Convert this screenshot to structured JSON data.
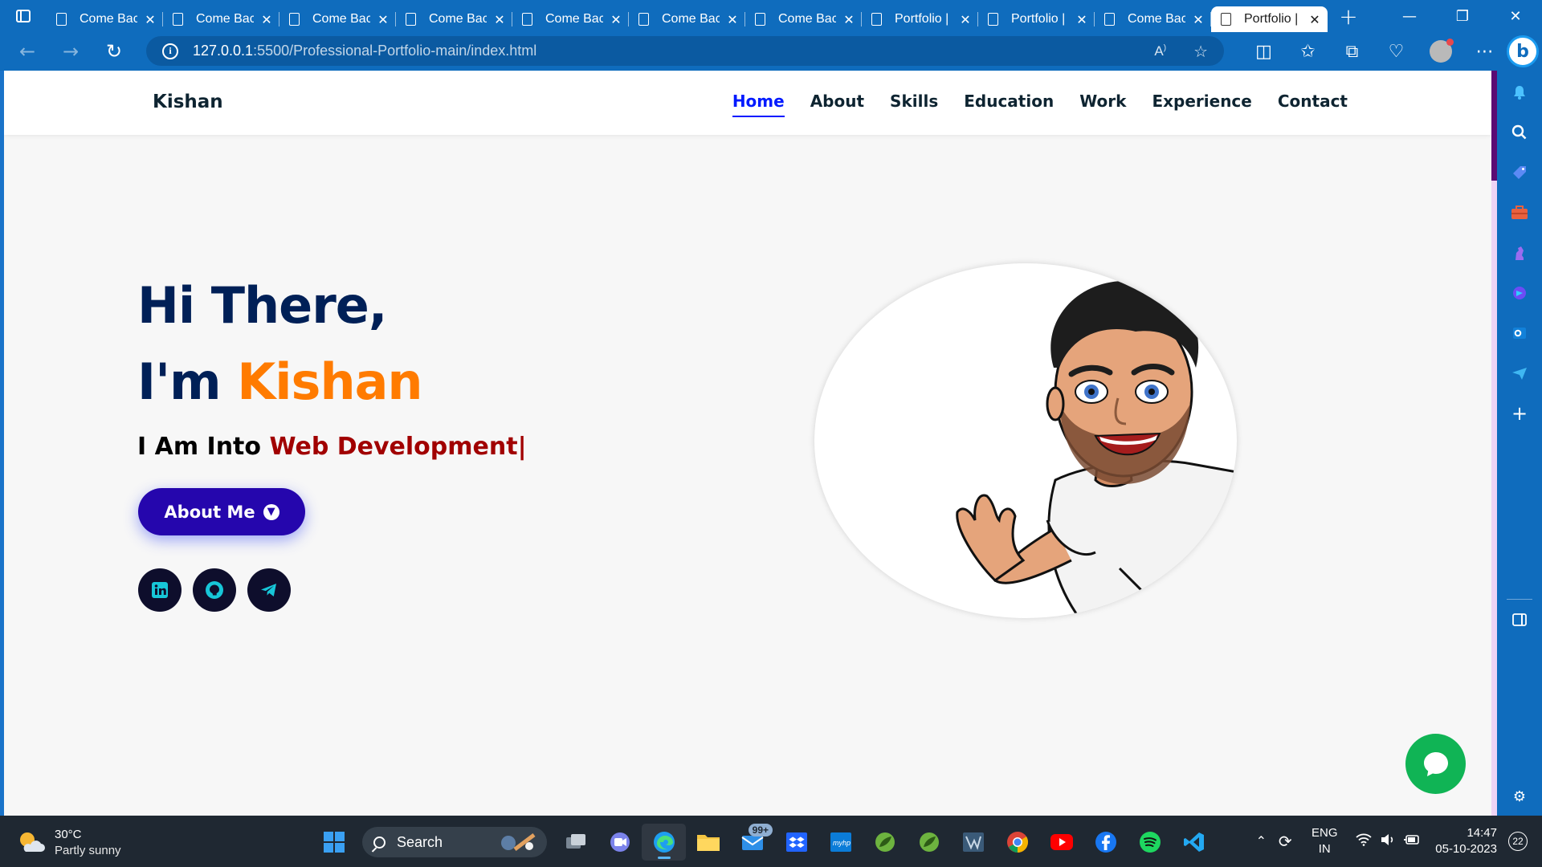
{
  "browser": {
    "tabs": [
      {
        "label": "Come Back"
      },
      {
        "label": "Come Back"
      },
      {
        "label": "Come Back"
      },
      {
        "label": "Come Back"
      },
      {
        "label": "Come Back"
      },
      {
        "label": "Come Back"
      },
      {
        "label": "Come Back"
      },
      {
        "label": "Portfolio |"
      },
      {
        "label": "Portfolio |"
      },
      {
        "label": "Come Back"
      },
      {
        "label": "Portfolio |"
      }
    ],
    "active_tab_index": 10,
    "new_tab_label": "+",
    "address": {
      "host": "127.0.0.1",
      "path": ":5500/Professional-Portfolio-main/index.html"
    }
  },
  "site": {
    "logo": "Kishan",
    "nav": [
      {
        "label": "Home",
        "active": true
      },
      {
        "label": "About"
      },
      {
        "label": "Skills"
      },
      {
        "label": "Education"
      },
      {
        "label": "Work"
      },
      {
        "label": "Experience"
      },
      {
        "label": "Contact"
      }
    ],
    "hero": {
      "line1": "Hi There,",
      "line2_prefix": "I'm ",
      "line2_name": "Kishan",
      "subtitle_prefix": "I Am Into ",
      "subtitle_typed": "Web Development|",
      "cta_label": "About Me"
    },
    "socials": [
      {
        "icon": "linkedin-icon"
      },
      {
        "icon": "github-icon"
      },
      {
        "icon": "telegram-icon"
      }
    ],
    "colors": {
      "nav_active": "#011aff",
      "heading": "#002057",
      "accent_name": "#ff7b00",
      "typed_text": "#a10000",
      "cta_bg": "#2506ad",
      "chat_bubble": "#10b455"
    }
  },
  "taskbar": {
    "weather": {
      "temp": "30°C",
      "desc": "Partly sunny"
    },
    "search_label": "Search",
    "mail_badge": "99+",
    "language": {
      "line1": "ENG",
      "line2": "IN"
    },
    "clock": {
      "time": "14:47",
      "date": "05-10-2023"
    },
    "notification_count": "22"
  }
}
